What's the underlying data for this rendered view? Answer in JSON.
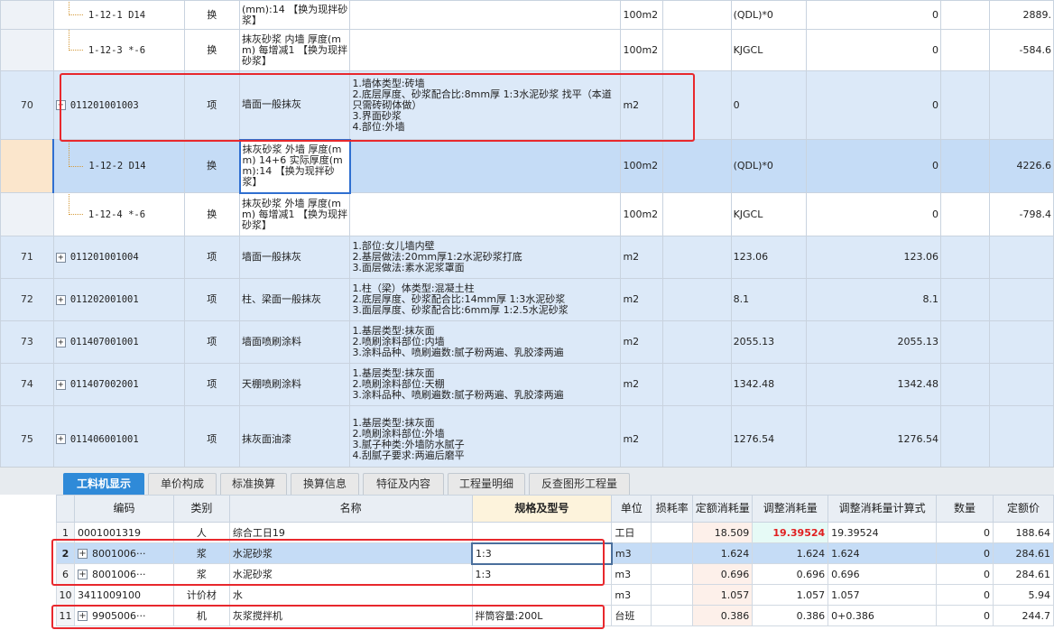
{
  "upper_rows": [
    {
      "rownum": "",
      "code": "1-12-1 D14",
      "type": "换",
      "name": "(mm):14 【换为现拌砂浆】",
      "features": "",
      "unit": "100m2",
      "expr": "(QDL)*0",
      "qty": "0",
      "price": "2889."
    },
    {
      "rownum": "",
      "code": "1-12-3 *-6",
      "type": "换",
      "name": "抹灰砂浆 内墙 厚度(mm) 每增减1 【换为现拌砂浆】",
      "features": "",
      "unit": "100m2",
      "expr": "KJGCL",
      "qty": "0",
      "price": "-584.6"
    },
    {
      "rownum": "70",
      "code": "011201001003",
      "type": "项",
      "name": "墙面一般抹灰",
      "features": "1.墙体类型:砖墙\n2.底层厚度、砂浆配合比:8mm厚 1:3水泥砂浆 找平（本道只需砖砌体做）\n3.界面砂浆\n4.部位:外墙",
      "unit": "m2",
      "expr": "0",
      "qty": "0",
      "price": ""
    },
    {
      "rownum": "",
      "code": "1-12-2 D14",
      "type": "换",
      "name": "抹灰砂浆 外墙 厚度(mm) 14+6  实际厚度(mm):14 【换为现拌砂浆】",
      "features": "",
      "unit": "100m2",
      "expr": "(QDL)*0",
      "qty": "0",
      "price": "4226.6"
    },
    {
      "rownum": "",
      "code": "1-12-4 *-6",
      "type": "换",
      "name": "抹灰砂浆 外墙 厚度(mm) 每增减1 【换为现拌砂浆】",
      "features": "",
      "unit": "100m2",
      "expr": "KJGCL",
      "qty": "0",
      "price": "-798.4"
    },
    {
      "rownum": "71",
      "code": "011201001004",
      "type": "项",
      "name": "墙面一般抹灰",
      "features": "1.部位:女儿墙内壁\n2.基层做法:20mm厚1:2水泥砂浆打底\n3.面层做法:素水泥浆罩面",
      "unit": "m2",
      "expr": "123.06",
      "qty": "123.06",
      "price": ""
    },
    {
      "rownum": "72",
      "code": "011202001001",
      "type": "项",
      "name": "柱、梁面一般抹灰",
      "features": "1.柱（梁）体类型:混凝土柱\n2.底层厚度、砂浆配合比:14mm厚 1:3水泥砂浆\n3.面层厚度、砂浆配合比:6mm厚 1:2.5水泥砂浆",
      "unit": "m2",
      "expr": "8.1",
      "qty": "8.1",
      "price": ""
    },
    {
      "rownum": "73",
      "code": "011407001001",
      "type": "项",
      "name": "墙面喷刷涂料",
      "features": "1.基层类型:抹灰面\n2.喷刷涂料部位:内墙\n3.涂料品种、喷刷遍数:腻子粉两遍、乳胶漆两遍",
      "unit": "m2",
      "expr": "2055.13",
      "qty": "2055.13",
      "price": ""
    },
    {
      "rownum": "74",
      "code": "011407002001",
      "type": "项",
      "name": "天棚喷刷涂料",
      "features": "1.基层类型:抹灰面\n2.喷刷涂料部位:天棚\n3.涂料品种、喷刷遍数:腻子粉两遍、乳胶漆两遍",
      "unit": "m2",
      "expr": "1342.48",
      "qty": "1342.48",
      "price": ""
    },
    {
      "rownum": "75",
      "code": "011406001001",
      "type": "项",
      "name": "抹灰面油漆",
      "features": "1.基层类型:抹灰面\n2.喷刷涂料部位:外墙\n3.腻子种类:外墙防水腻子\n4.刮腻子要求:两遍后磨平",
      "unit": "m2",
      "expr": "1276.54",
      "qty": "1276.54",
      "price": ""
    }
  ],
  "tabs": [
    "工料机显示",
    "单价构成",
    "标准换算",
    "换算信息",
    "特征及内容",
    "工程量明细",
    "反查图形工程量"
  ],
  "lower_headers": [
    "编码",
    "类别",
    "名称",
    "规格及型号",
    "单位",
    "损耗率",
    "定额消耗量",
    "调整消耗量",
    "调整消耗量计算式",
    "数量",
    "定额价"
  ],
  "lower_rows": [
    {
      "rownum": "1",
      "code": "0001001319",
      "cat": "人",
      "name": "综合工日19",
      "spec": "",
      "unit": "工日",
      "loss": "",
      "dqty": "18.509",
      "aqty": "19.39524",
      "aexpr": "19.39524",
      "qty": "0",
      "price": "188.64"
    },
    {
      "rownum": "2",
      "code": "8001006···",
      "cat": "浆",
      "name": "水泥砂浆",
      "spec": "1:3",
      "unit": "m3",
      "loss": "",
      "dqty": "1.624",
      "aqty": "1.624",
      "aexpr": "1.624",
      "qty": "0",
      "price": "284.61"
    },
    {
      "rownum": "6",
      "code": "8001006···",
      "cat": "浆",
      "name": "水泥砂浆",
      "spec": "1:3",
      "unit": "m3",
      "loss": "",
      "dqty": "0.696",
      "aqty": "0.696",
      "aexpr": "0.696",
      "qty": "0",
      "price": "284.61"
    },
    {
      "rownum": "10",
      "code": "3411009100",
      "cat": "计价材",
      "name": "水",
      "spec": "",
      "unit": "m3",
      "loss": "",
      "dqty": "1.057",
      "aqty": "1.057",
      "aexpr": "1.057",
      "qty": "0",
      "price": "5.94"
    },
    {
      "rownum": "11",
      "code": "9905006···",
      "cat": "机",
      "name": "灰浆搅拌机",
      "spec": "拌筒容量:200L",
      "unit": "台班",
      "loss": "",
      "dqty": "0.386",
      "aqty": "0.386",
      "aexpr": "0+0.386",
      "qty": "0",
      "price": "244.7"
    }
  ]
}
